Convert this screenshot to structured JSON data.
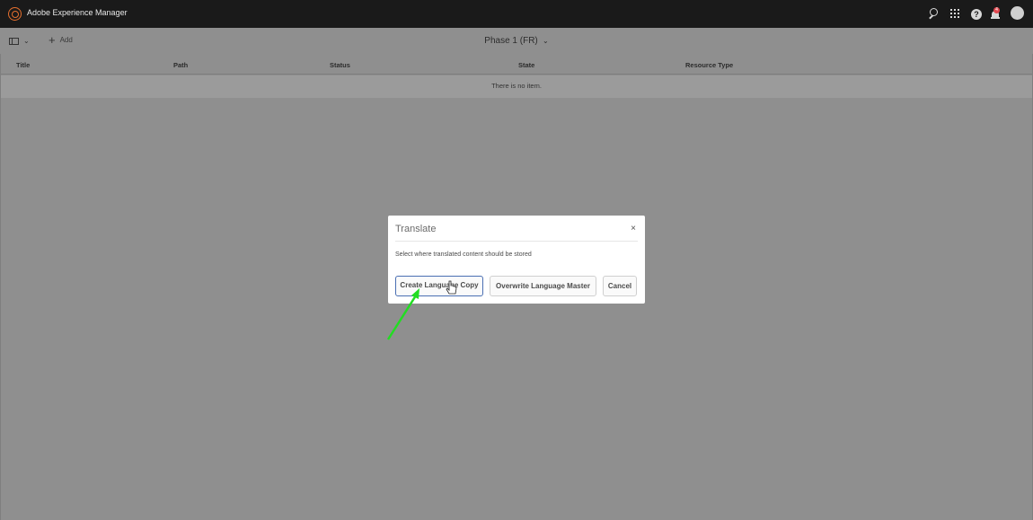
{
  "shell": {
    "app_title": "Adobe Experience Manager",
    "notification_count": "4",
    "icons": [
      "adobe-logo-icon",
      "search-icon",
      "apps-icon",
      "help-icon",
      "bell-icon",
      "avatar-icon"
    ]
  },
  "actionbar": {
    "add_label": "Add",
    "page_title": "Phase 1 (FR)"
  },
  "table": {
    "columns": [
      "Title",
      "Path",
      "Status",
      "State",
      "Resource Type"
    ],
    "empty_message": "There is no item."
  },
  "dialog": {
    "title": "Translate",
    "close_glyph": "×",
    "message": "Select where translated content should be stored",
    "buttons": {
      "create": "Create Language Copy",
      "overwrite": "Overwrite Language Master",
      "cancel": "Cancel"
    }
  },
  "colors": {
    "shell_bg": "#1a1a1a",
    "overlay_bg": "#8f8f8f",
    "brand_orange": "#e6702e",
    "annotation_arrow": "#22dd22",
    "focus_border": "#4a6fb3"
  }
}
